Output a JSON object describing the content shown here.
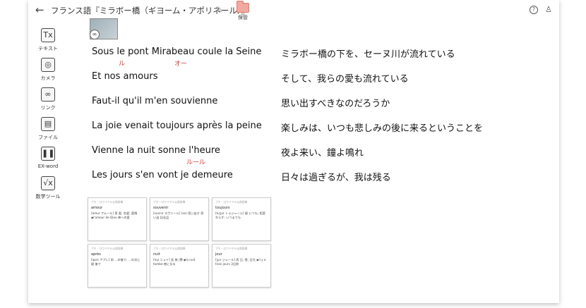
{
  "header": {
    "back_icon": "←",
    "title": "フランス語『ミラボー橋（ギヨーム・アポリネール）』",
    "save_label": "保管"
  },
  "sidebar": {
    "items": [
      {
        "label": "テキスト",
        "icon": "Tx"
      },
      {
        "label": "カメラ",
        "icon": "◎"
      },
      {
        "label": "リンク",
        "icon": "∞"
      },
      {
        "label": "ファイル",
        "icon": "▤"
      },
      {
        "label": "EX-word",
        "icon": "❚❚"
      },
      {
        "label": "数学ツール",
        "icon": "√x"
      }
    ]
  },
  "lines": [
    {
      "fr": "Sous le pont Mirabeau coule la Seine",
      "ja": "ミラボー橋の下を、セーヌ川が流れている"
    },
    {
      "fr": "Et nos amours",
      "ja": "そして、我らの愛も流れている"
    },
    {
      "fr": "Faut-il qu'il m'en souvienne",
      "ja": "思い出すべきなのだろうか"
    },
    {
      "fr": "La joie venait toujours après la peine",
      "ja": "楽しみは、いつも悲しみの後に来るということを"
    },
    {
      "fr": "Vienne la nuit sonne l'heure",
      "ja": "夜よ来い、鐘よ鳴れ"
    },
    {
      "fr": "Les jours s'en vont je demeure",
      "ja": "日々は過ぎるが、我は残る"
    }
  ],
  "annotations": {
    "le": "ル",
    "mirabeau": "オー",
    "heure": "ルール"
  },
  "cards": [
    {
      "head": "ブチ・ロワイヤル仏和辞典",
      "word": "amour",
      "body": "[amur アムール] 男 愛, 恋愛; 愛情 ◆l'amour de Dieu 神への愛"
    },
    {
      "head": "ブチ・ロワイヤル仏和辞典",
      "word": "souvenir",
      "body": "[suvnir スヴニール] (se) 思い出す 思い出 記念品"
    },
    {
      "head": "ブチ・ロワイヤル仏和辞典",
      "word": "toujours",
      "body": "[tuʒur トゥジュール] 副 いつも; 相変わらず; いつまでも"
    },
    {
      "head": "ブチ・ロワイヤル仏和辞典",
      "word": "après",
      "body": "[aprɛ アプレ] 前 …の後で; …の次に 副 後で"
    },
    {
      "head": "ブチ・ロワイヤル仏和辞典",
      "word": "nuit",
      "body": "[nɥi ニュイ] 女 夜; 闇 ◆la nuit tombe 夜になる"
    },
    {
      "head": "ブチ・ロワイヤル仏和辞典",
      "word": "jour",
      "body": "[ʒur ジュール] 男 日, 昼; 日光 ◆il y a trois jours 3日前"
    }
  ]
}
